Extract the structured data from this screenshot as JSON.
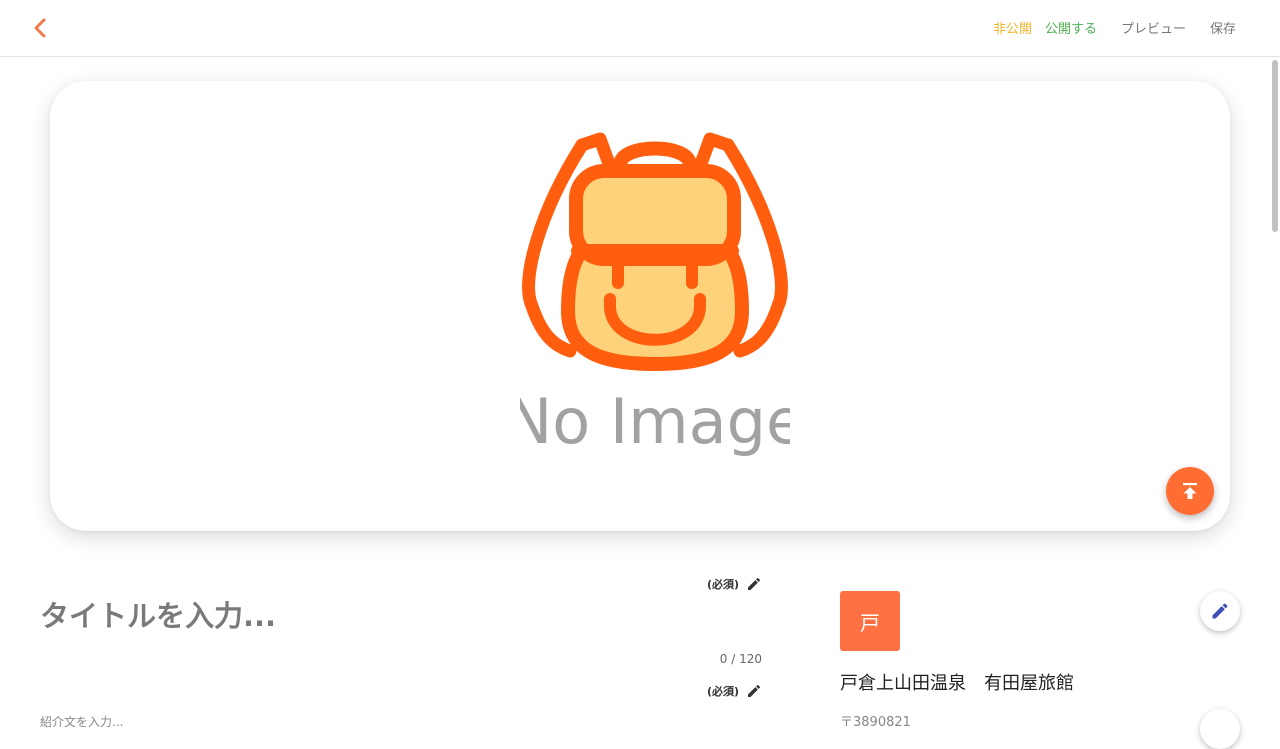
{
  "topbar": {
    "status_label": "非公開",
    "publish_label": "公開する",
    "preview_label": "プレビュー",
    "save_label": "保存"
  },
  "cover": {
    "placeholder_text": "No Image",
    "placeholder_icon": "backpack-icon",
    "upload_icon": "upload-icon"
  },
  "editor": {
    "title_required": "(必須)",
    "title_placeholder": "タイトルを入力...",
    "title_value": "",
    "title_count": "0 / 120",
    "description_required": "(必須)",
    "description_cut": "紹介文を入力..."
  },
  "spot": {
    "avatar_char": "戸",
    "name": "戸倉上山田温泉　有田屋旅館",
    "zip": "〒3890821"
  },
  "colors": {
    "accent": "#ff6d33",
    "backpack_outline": "#ff5e0e",
    "backpack_fill": "#fdd27a",
    "status_private": "#f0b429",
    "publish": "#4caf50",
    "edit_blue": "#3f51b5"
  }
}
